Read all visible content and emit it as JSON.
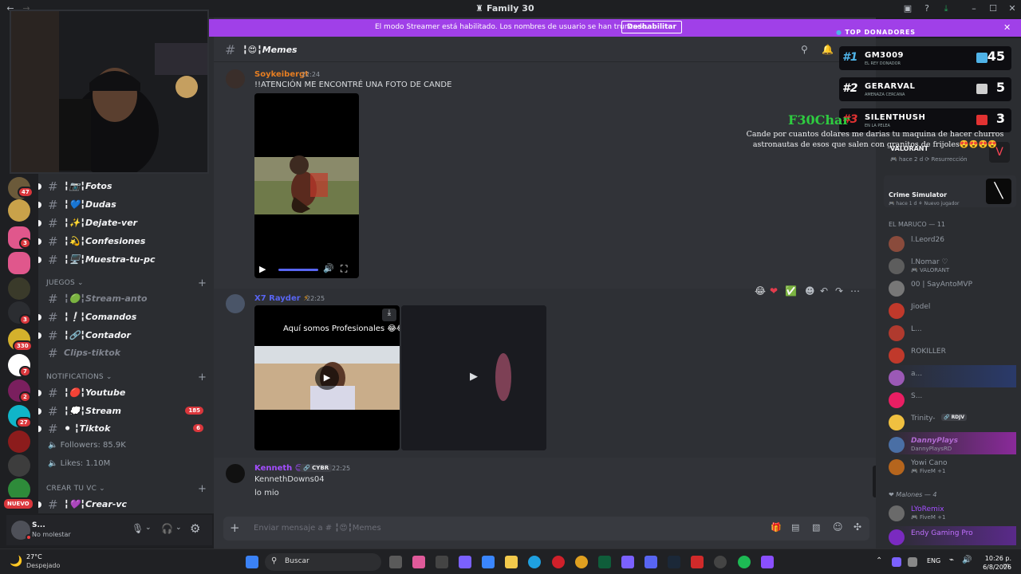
{
  "window": {
    "title": "Family 30"
  },
  "streamer_banner": {
    "text": "El modo Streamer está habilitado. Los nombres de usuario se han truncado.",
    "button": "Deshabilitar"
  },
  "rail": {
    "badges": [
      "47",
      "3",
      "3",
      "330",
      "7",
      "2",
      "27",
      "NUEVO"
    ]
  },
  "sidebar": {
    "channels_top": [
      {
        "icon": "📷",
        "label": "Fotos"
      },
      {
        "icon": "💙",
        "label": "Dudas"
      },
      {
        "icon": "✨",
        "label": "Dejate-ver"
      },
      {
        "icon": "💫",
        "label": "Confesiones"
      },
      {
        "icon": "🖥️",
        "label": "Muestra-tu-pc"
      }
    ],
    "cat_juegos": "JUEGOS",
    "channels_juegos": [
      {
        "icon": "🟢",
        "label": "Stream-anto"
      },
      {
        "icon": "❕",
        "label": "Comandos"
      },
      {
        "icon": "🔗",
        "label": "Contador"
      },
      {
        "icon": "",
        "label": "Clips-tiktok"
      }
    ],
    "cat_notifications": "NOTIFICATIONS",
    "channels_notif": [
      {
        "icon": "🔴",
        "label": "Youtube",
        "count": ""
      },
      {
        "icon": "💭",
        "label": "Stream",
        "count": "185"
      },
      {
        "icon": "⚫",
        "label": "Tiktok",
        "count": "6"
      }
    ],
    "voice": [
      {
        "label": "Followers: 85.9K"
      },
      {
        "label": "Likes: 1.10M"
      }
    ],
    "cat_crear": "CREAR TU VC",
    "channel_crear": {
      "icon": "💜",
      "label": "Crear-vc"
    },
    "user": {
      "name": "S...",
      "status": "No molestar"
    }
  },
  "channel_header": {
    "name": "Memes",
    "icon": "😍"
  },
  "messages": [
    {
      "author": "Soykeibergt",
      "time": "22:24",
      "text": "!!ATENCIÓN ME ENCONTRÉ UNA FOTO DE CANDE",
      "color": "#e67e22"
    },
    {
      "author": "X7 Rayder",
      "time": "22:25",
      "video_caption": "Aquí somos Profesionales 😂😂",
      "color": "#5865f2"
    },
    {
      "author": "Kenneth",
      "time": "22:25",
      "tag": "CYBR",
      "lines": [
        "KennethDowns04",
        "lo mio"
      ],
      "color": "#a34eff"
    }
  ],
  "composer": {
    "placeholder": "Enviar mensaje a # ╏😍╏Memes"
  },
  "overlay": {
    "title": "TOP DONADORES",
    "donors": [
      {
        "rank": "#1",
        "name": "GM3009",
        "sub": "EL REY DONADOR",
        "amount": "45",
        "gift_color": "#4fb3e8"
      },
      {
        "rank": "#2",
        "name": "GERARVAL",
        "sub": "AMENAZA CERCANA",
        "amount": "5",
        "gift_color": "#cfcfcf"
      },
      {
        "rank": "#3",
        "name": "SILENTHUSH",
        "sub": "EN LA PELEA",
        "amount": "3",
        "gift_color": "#e23232"
      }
    ],
    "brand": "F30Char",
    "chat_msg": "Cande por cuantos dolares me darias tu maquina de hacer churros astronautas de esos que salen con granitos de frijoles😍😍😍😍"
  },
  "members": {
    "activity1": {
      "title": "VALORANT",
      "time": "hace 2 d",
      "extra": "Resurrección"
    },
    "activity2": {
      "title": "Crime Simulator",
      "time": "hace 1 d",
      "extra": "Nuevo jugador"
    },
    "group1": "EL MARUCO — 11",
    "list1": [
      {
        "name": "l.Leord26",
        "sub": ""
      },
      {
        "name": "l.Nomar ♡",
        "sub": "VALORANT"
      },
      {
        "name": "00 | SayAntoMVP",
        "sub": ""
      },
      {
        "name": "Jiodel",
        "sub": ""
      },
      {
        "name": "L...",
        "sub": ""
      },
      {
        "name": "ROKILLER",
        "sub": ""
      },
      {
        "name": "a...",
        "sub": ""
      },
      {
        "name": "S...",
        "sub": ""
      },
      {
        "name": "Trinity-",
        "sub": "",
        "tag": "RDJV"
      },
      {
        "name": "DannyPlays",
        "sub": "DannyPlaysRD"
      },
      {
        "name": "Yowi Cano",
        "sub": "FiveM +1"
      }
    ],
    "group2": "Malones — 4",
    "list2": [
      {
        "name": "LYoRemix",
        "sub": "FiveM +1"
      },
      {
        "name": "Endy Gaming Pro",
        "sub": ""
      }
    ]
  },
  "taskbar": {
    "weather_temp": "27°C",
    "weather_desc": "Despejado",
    "search": "Buscar",
    "lang": "ENG",
    "time": "10:26 p. m.",
    "date": "6/8/2026"
  }
}
